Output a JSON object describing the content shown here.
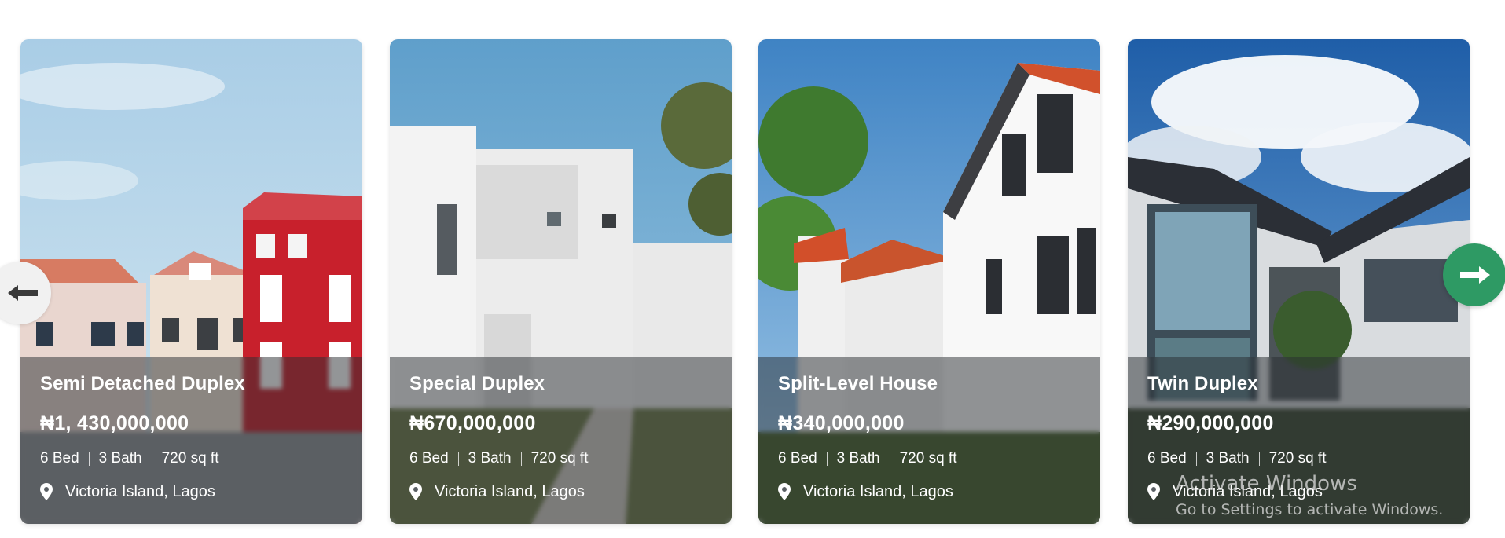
{
  "listings": [
    {
      "title": "Semi Detached Duplex",
      "price": "₦1, 430,000,000",
      "beds": "6 Bed",
      "baths": "3 Bath",
      "area": "720 sq ft",
      "location": "Victoria Island, Lagos"
    },
    {
      "title": "Special Duplex",
      "price": "₦670,000,000",
      "beds": "6 Bed",
      "baths": "3 Bath",
      "area": "720 sq ft",
      "location": "Victoria Island, Lagos"
    },
    {
      "title": "Split-Level House",
      "price": "₦340,000,000",
      "beds": "6 Bed",
      "baths": "3 Bath",
      "area": "720 sq ft",
      "location": "Victoria Island, Lagos"
    },
    {
      "title": "Twin Duplex",
      "price": "₦290,000,000",
      "beds": "6 Bed",
      "baths": "3 Bath",
      "area": "720 sq ft",
      "location": "Victoria Island, Lagos"
    }
  ],
  "nav": {
    "prev_icon": "arrow-left-icon",
    "next_icon": "arrow-right-icon"
  },
  "icons": {
    "location": "map-pin-icon"
  },
  "colors": {
    "next_button": "#2e9a64",
    "prev_button": "#f1f1f1",
    "overlay_text": "#ffffff"
  },
  "watermark": {
    "title": "Activate Windows",
    "subtitle": "Go to Settings to activate Windows."
  }
}
